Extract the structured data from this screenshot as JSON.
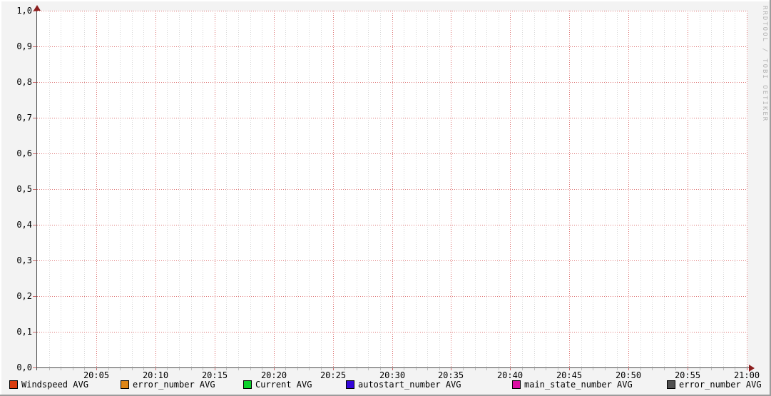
{
  "watermark": "RRDTOOL / TOBI OETIKER",
  "colors": {
    "background": "#f3f3f3",
    "canvas": "#ffffff",
    "grid_minor": "#d7d7d7",
    "grid_major": "#dd7373",
    "axis": "#4a4a4a",
    "arrow": "#8b1e1e",
    "text": "#000000",
    "watermark_text": "#b4b4b4"
  },
  "chart_data": {
    "type": "line",
    "title": "",
    "xlabel": "",
    "ylabel": "",
    "x_range": [
      "20:00",
      "21:00"
    ],
    "x_tick_labels": [
      "20:05",
      "20:10",
      "20:15",
      "20:20",
      "20:25",
      "20:30",
      "20:35",
      "20:40",
      "20:45",
      "20:50",
      "20:55",
      "21:00"
    ],
    "x_minor_step_minutes": 1,
    "x_major_step_minutes": 5,
    "y_tick_labels": [
      "0,0",
      "0,1",
      "0,2",
      "0,3",
      "0,4",
      "0,5",
      "0,6",
      "0,7",
      "0,8",
      "0,9",
      "1,0"
    ],
    "ylim": [
      0,
      1
    ],
    "grid": true,
    "legend_position": "bottom",
    "series": [
      {
        "name": "Windspeed AVG",
        "color": "#d93b0d",
        "values": []
      },
      {
        "name": "error_number AVG",
        "color": "#de8617",
        "values": []
      },
      {
        "name": "Current AVG",
        "color": "#0cd22c",
        "values": []
      },
      {
        "name": "autostart_number AVG",
        "color": "#3305d9",
        "values": []
      },
      {
        "name": "main_state_number AVG",
        "color": "#db0ea2",
        "values": []
      },
      {
        "name": "error_number AVG",
        "color": "#4f4f4f",
        "values": []
      }
    ]
  }
}
